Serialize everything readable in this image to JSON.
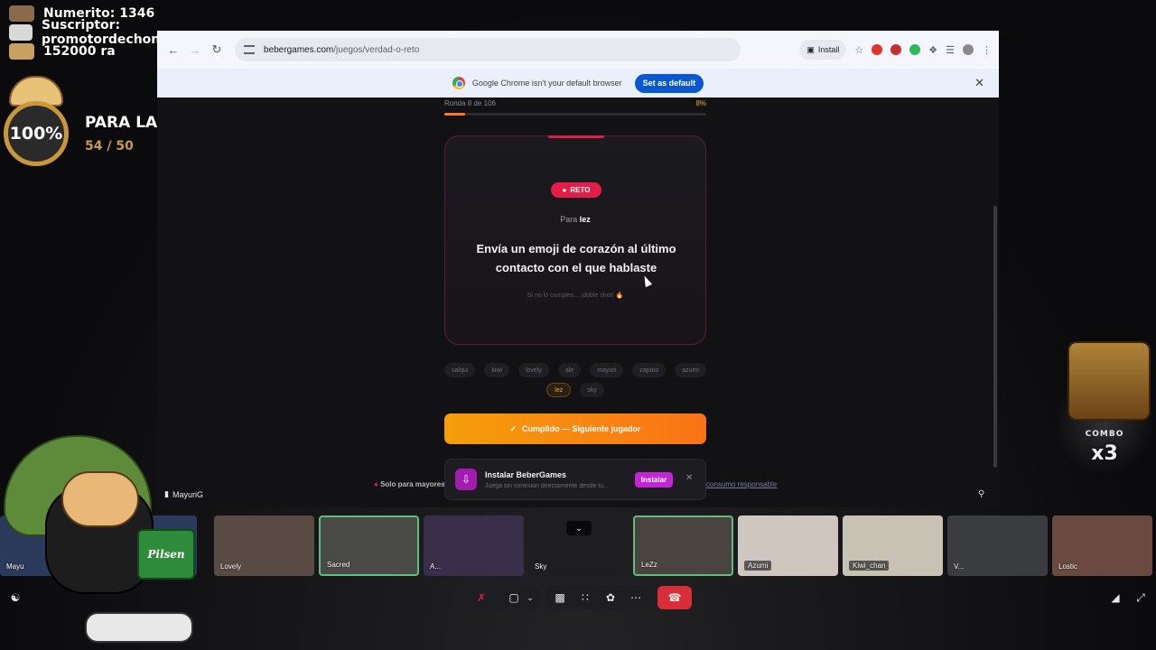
{
  "overlay": {
    "stats": [
      {
        "text": "Numerito: 1346"
      },
      {
        "text": "Suscriptor: promotordechongos_tv"
      },
      {
        "text": "152000   ra"
      }
    ],
    "goal": {
      "percent_label": "100%",
      "title": "PARA LA PC",
      "count": "54 / 50"
    },
    "combo": {
      "label": "COMBO",
      "value": "x3"
    },
    "mascot_text": "Pilsen"
  },
  "browser": {
    "url_host": "bebergames.com",
    "url_path": "/juegos/verdad-o-reto",
    "install_label": "Install",
    "infobar": {
      "message": "Google Chrome isn't your default browser",
      "button": "Set as default"
    },
    "ext_colors": [
      "#e0332b",
      "#c4302b",
      "#2fb85a"
    ]
  },
  "game": {
    "round_label": "Ronda 8 de 106",
    "progress_label": "8%",
    "progress": 0.08,
    "badge": "RETO",
    "para_prefix": "Para",
    "player": "lez",
    "challenge": "Envía un emoji de corazón al último contacto con el que hablaste",
    "hint": "Si no lo cumples... ¡doble shot! 🔥",
    "players": [
      "valqui",
      "kiwi",
      "lovely",
      "ale",
      "mayuri",
      "zapato",
      "azumi",
      "lez",
      "sky"
    ],
    "active_player": "lez",
    "cta": "Cumplido — Siguiente jugador",
    "footer_note": "Solo para mayores",
    "footer_link": "consumo responsable",
    "pwa": {
      "title": "Instalar BeberGames",
      "subtitle": "Juega sin conexión directamente desde tu...",
      "button": "Instalar"
    }
  },
  "meeting": {
    "speaker": "MayuriG",
    "participants": [
      {
        "name": "Mayu",
        "color": "#2a3a5a"
      },
      {
        "name": "Lovely",
        "color": "#5a4a44"
      },
      {
        "name": "Sacred",
        "color": "#4a4a48"
      },
      {
        "name": "A...",
        "color": "#3a2f4a"
      },
      {
        "name": "Sky",
        "color": "#1e1e22"
      },
      {
        "name": "LeZz",
        "color": "#4a4440"
      },
      {
        "name": "Azumi",
        "color": "#cfc6c0"
      },
      {
        "name": "Kiwi_chan",
        "color": "#c8c2b4"
      },
      {
        "name": "V...",
        "color": "#3a3c40"
      },
      {
        "name": "Lostic",
        "color": "#6a4a40"
      }
    ],
    "colors": {
      "speaking": "#5fbf7a",
      "end_call": "#d92d3a",
      "accent": "#f97316"
    }
  }
}
